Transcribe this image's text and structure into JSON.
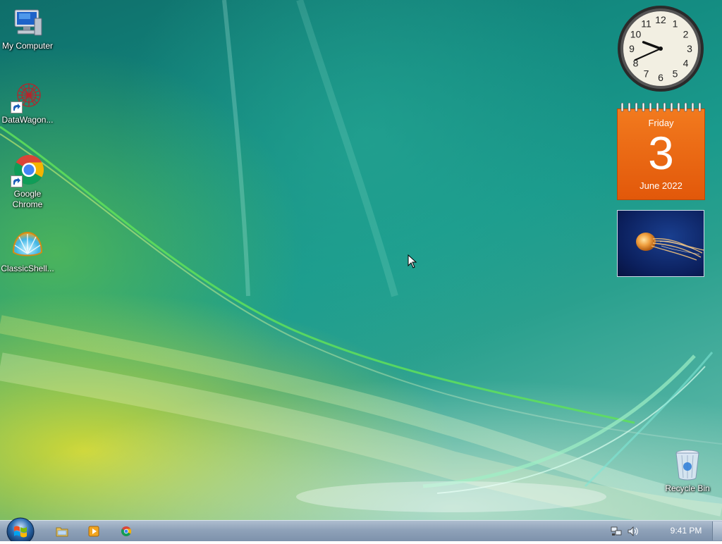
{
  "desktop": {
    "icons": [
      {
        "label": "My Computer",
        "icon": "computer-icon"
      },
      {
        "label": "DataWagon...",
        "icon": "datawagon-icon"
      },
      {
        "label": "Google Chrome",
        "icon": "chrome-icon"
      },
      {
        "label": "ClassicShell...",
        "icon": "classicshell-icon"
      },
      {
        "label": "Recycle Bin",
        "icon": "recycle-bin-icon"
      }
    ]
  },
  "gadgets": {
    "clock": {
      "numerals": [
        "12",
        "1",
        "2",
        "3",
        "4",
        "5",
        "6",
        "7",
        "8",
        "9",
        "10",
        "11"
      ],
      "hour": 9,
      "minute": 41
    },
    "calendar": {
      "weekday": "Friday",
      "day": "3",
      "month_year": "June 2022"
    },
    "slideshow": {
      "icon": "jellyfish-image"
    }
  },
  "taskbar": {
    "start_icon": "windows-logo-icon",
    "pinned": [
      {
        "icon": "file-explorer-icon"
      },
      {
        "icon": "media-player-icon"
      },
      {
        "icon": "chrome-icon"
      }
    ],
    "tray": {
      "network_icon": "network-icon",
      "volume_icon": "volume-icon",
      "time": "9:41 PM"
    }
  },
  "colors": {
    "calendar_orange": "#ee6a12",
    "taskbar": "#8fa2b9",
    "desktop_teal": "#138a80"
  }
}
